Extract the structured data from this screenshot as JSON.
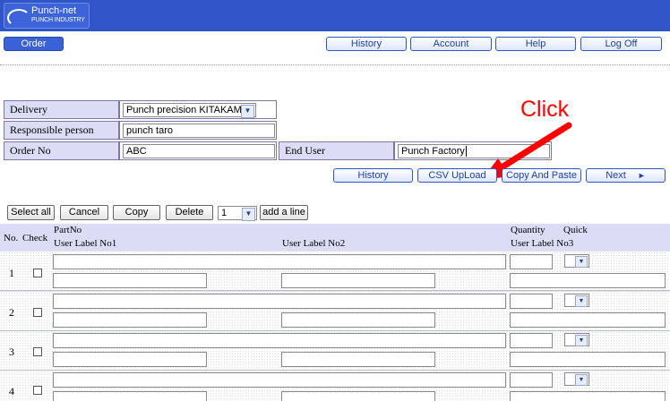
{
  "brand": {
    "name": "Punch-net",
    "tagline": "PUNCH INDUSTRY"
  },
  "nav": {
    "order": "Order",
    "history": "History",
    "account": "Account",
    "help": "Help",
    "logoff": "Log Off"
  },
  "form": {
    "delivery_label": "Delivery",
    "delivery_value": "Punch precision KITAKAMI",
    "responsible_label": "Responsible person",
    "responsible_value": "punch taro",
    "orderno_label": "Order No",
    "orderno_value": "ABC",
    "enduser_label": "End User",
    "enduser_value": "Punch Factory"
  },
  "annotation": {
    "text": "Click"
  },
  "actions": {
    "history": "History",
    "csv": "CSV UpLoad",
    "copy_paste": "Copy And Paste",
    "next": "Next"
  },
  "toolbar": {
    "select_all": "Select all",
    "cancel": "Cancel",
    "copy": "Copy",
    "delete": "Delete",
    "count": "1",
    "add_line": "add a line"
  },
  "table": {
    "col_no": "No.",
    "col_check": "Check",
    "col_partno": "PartNo",
    "col_quantity": "Quantity",
    "col_quick": "Quick",
    "col_label1": "User Label No1",
    "col_label2": "User Label No2",
    "col_label3": "User Label No3",
    "rows": [
      "1",
      "2",
      "3",
      "4"
    ]
  },
  "colors": {
    "header": "#2f55c9",
    "accent_red": "#ff0000",
    "label_bg": "#dcdcf7"
  }
}
